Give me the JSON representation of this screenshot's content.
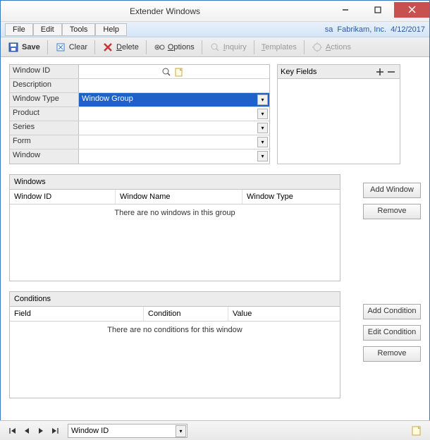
{
  "title": "Extender Windows",
  "menubar": {
    "file": "File",
    "edit": "Edit",
    "tools": "Tools",
    "help": "Help"
  },
  "status": {
    "user": "sa",
    "company": "Fabrikam, Inc.",
    "date": "4/12/2017"
  },
  "toolbar": {
    "save": "Save",
    "clear": "Clear",
    "delete": "Delete",
    "options": "Options",
    "inquiry": "Inquiry",
    "templates": "Templates",
    "actions": "Actions"
  },
  "form": {
    "window_id_label": "Window ID",
    "window_id_value": "",
    "description_label": "Description",
    "description_value": "",
    "window_type_label": "Window Type",
    "window_type_value": "Window Group",
    "product_label": "Product",
    "product_value": "",
    "series_label": "Series",
    "series_value": "",
    "form_label": "Form",
    "form_value": "",
    "window_label": "Window",
    "window_value": ""
  },
  "keyfields": {
    "header": "Key Fields"
  },
  "windows_panel": {
    "header": "Windows",
    "col_id": "Window ID",
    "col_name": "Window Name",
    "col_type": "Window Type",
    "empty": "There are no windows in this group",
    "add_btn": "Add Window",
    "remove_btn": "Remove"
  },
  "conditions_panel": {
    "header": "Conditions",
    "col_field": "Field",
    "col_condition": "Condition",
    "col_value": "Value",
    "empty": "There are no conditions for this window",
    "add_btn": "Add Condition",
    "edit_btn": "Edit Condition",
    "remove_btn": "Remove"
  },
  "nav": {
    "sort": "Window ID"
  }
}
